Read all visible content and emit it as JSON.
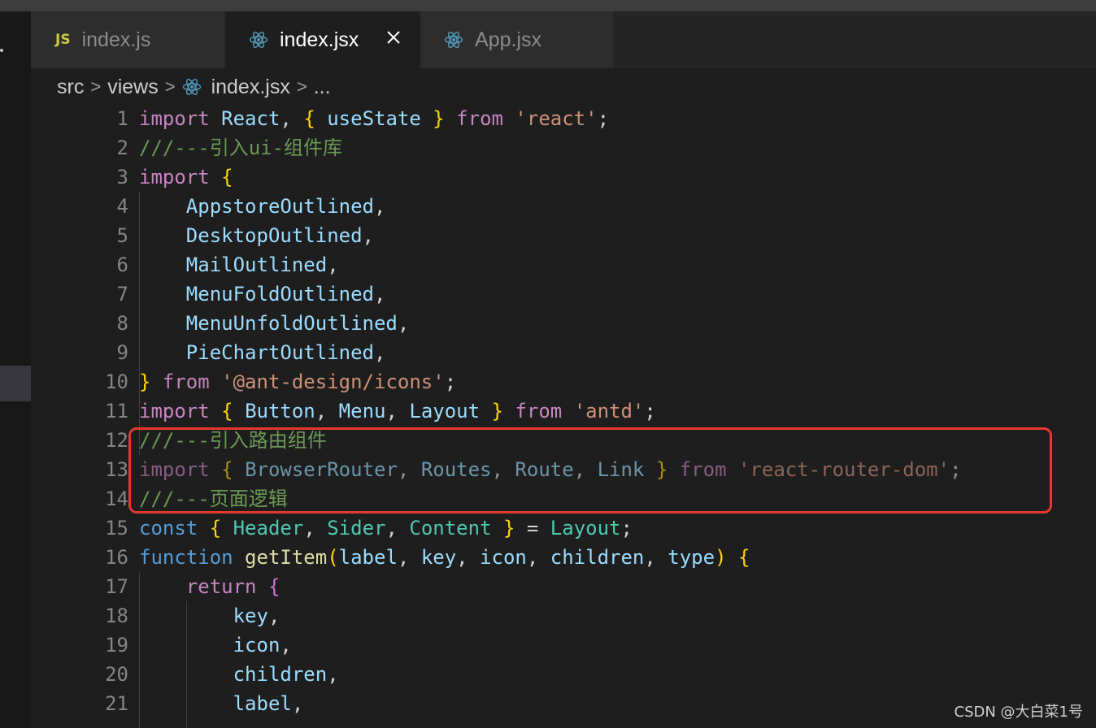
{
  "tabs": [
    {
      "label": "index.js",
      "icon": "js-file-icon",
      "badge": "JS",
      "active": false
    },
    {
      "label": "index.jsx",
      "icon": "react-icon",
      "active": true,
      "closable": true
    },
    {
      "label": "App.jsx",
      "icon": "react-icon",
      "active": false
    }
  ],
  "breadcrumb": {
    "items": [
      "src",
      "views",
      "index.jsx",
      "..."
    ],
    "separator": ">"
  },
  "code": {
    "line_numbers": [
      "1",
      "2",
      "3",
      "4",
      "5",
      "6",
      "7",
      "8",
      "9",
      "10",
      "11",
      "12",
      "13",
      "14",
      "15",
      "16",
      "17",
      "18",
      "19",
      "20",
      "21"
    ],
    "lines": [
      [
        [
          "kw",
          "import"
        ],
        [
          "p",
          " "
        ],
        [
          "id",
          "React"
        ],
        [
          "p",
          ", "
        ],
        [
          "b1",
          "{"
        ],
        [
          "p",
          " "
        ],
        [
          "id",
          "useState"
        ],
        [
          "p",
          " "
        ],
        [
          "b1",
          "}"
        ],
        [
          "p",
          " "
        ],
        [
          "kw",
          "from"
        ],
        [
          "p",
          " "
        ],
        [
          "str",
          "'react'"
        ],
        [
          "p",
          ";"
        ]
      ],
      [
        [
          "cm",
          "///---引入ui-组件库"
        ]
      ],
      [
        [
          "kw",
          "import"
        ],
        [
          "p",
          " "
        ],
        [
          "b1",
          "{"
        ]
      ],
      [
        [
          "p",
          "    "
        ],
        [
          "id",
          "AppstoreOutlined"
        ],
        [
          "p",
          ","
        ]
      ],
      [
        [
          "p",
          "    "
        ],
        [
          "id",
          "DesktopOutlined"
        ],
        [
          "p",
          ","
        ]
      ],
      [
        [
          "p",
          "    "
        ],
        [
          "id",
          "MailOutlined"
        ],
        [
          "p",
          ","
        ]
      ],
      [
        [
          "p",
          "    "
        ],
        [
          "id",
          "MenuFoldOutlined"
        ],
        [
          "p",
          ","
        ]
      ],
      [
        [
          "p",
          "    "
        ],
        [
          "id",
          "MenuUnfoldOutlined"
        ],
        [
          "p",
          ","
        ]
      ],
      [
        [
          "p",
          "    "
        ],
        [
          "id",
          "PieChartOutlined"
        ],
        [
          "p",
          ","
        ]
      ],
      [
        [
          "b1",
          "}"
        ],
        [
          "p",
          " "
        ],
        [
          "kw",
          "from"
        ],
        [
          "p",
          " "
        ],
        [
          "str",
          "'@ant-design/icons'"
        ],
        [
          "p",
          ";"
        ]
      ],
      [
        [
          "kw",
          "import"
        ],
        [
          "p",
          " "
        ],
        [
          "b1",
          "{"
        ],
        [
          "p",
          " "
        ],
        [
          "id",
          "Button"
        ],
        [
          "p",
          ", "
        ],
        [
          "id",
          "Menu"
        ],
        [
          "p",
          ", "
        ],
        [
          "id",
          "Layout"
        ],
        [
          "p",
          " "
        ],
        [
          "b1",
          "}"
        ],
        [
          "p",
          " "
        ],
        [
          "kw",
          "from"
        ],
        [
          "p",
          " "
        ],
        [
          "str",
          "'antd'"
        ],
        [
          "p",
          ";"
        ]
      ],
      [
        [
          "cm",
          "///---引入路由组件"
        ]
      ],
      [
        [
          "kw dim",
          "import"
        ],
        [
          "p dim",
          " "
        ],
        [
          "b1 dim",
          "{"
        ],
        [
          "p dim",
          " "
        ],
        [
          "id dim",
          "BrowserRouter"
        ],
        [
          "p dim",
          ", "
        ],
        [
          "id dim",
          "Routes"
        ],
        [
          "p dim",
          ", "
        ],
        [
          "id dim",
          "Route"
        ],
        [
          "p dim",
          ", "
        ],
        [
          "id dim",
          "Link"
        ],
        [
          "p dim",
          " "
        ],
        [
          "b1 dim",
          "}"
        ],
        [
          "p dim",
          " "
        ],
        [
          "kw dim",
          "from"
        ],
        [
          "p dim",
          " "
        ],
        [
          "str dim",
          "'react-router-dom'"
        ],
        [
          "p dim",
          ";"
        ]
      ],
      [
        [
          "cm",
          "///---页面逻辑"
        ]
      ],
      [
        [
          "kwb",
          "const"
        ],
        [
          "p",
          " "
        ],
        [
          "b1",
          "{"
        ],
        [
          "p",
          " "
        ],
        [
          "type",
          "Header"
        ],
        [
          "p",
          ", "
        ],
        [
          "type",
          "Sider"
        ],
        [
          "p",
          ", "
        ],
        [
          "type",
          "Content"
        ],
        [
          "p",
          " "
        ],
        [
          "b1",
          "}"
        ],
        [
          "p",
          " = "
        ],
        [
          "type",
          "Layout"
        ],
        [
          "p",
          ";"
        ]
      ],
      [
        [
          "kwb",
          "function"
        ],
        [
          "p",
          " "
        ],
        [
          "fn",
          "getItem"
        ],
        [
          "b1",
          "("
        ],
        [
          "id",
          "label"
        ],
        [
          "p",
          ", "
        ],
        [
          "id",
          "key"
        ],
        [
          "p",
          ", "
        ],
        [
          "id",
          "icon"
        ],
        [
          "p",
          ", "
        ],
        [
          "id",
          "children"
        ],
        [
          "p",
          ", "
        ],
        [
          "id",
          "type"
        ],
        [
          "b1",
          ")"
        ],
        [
          "p",
          " "
        ],
        [
          "b1",
          "{"
        ]
      ],
      [
        [
          "p",
          "    "
        ],
        [
          "kw",
          "return"
        ],
        [
          "p",
          " "
        ],
        [
          "b2",
          "{"
        ]
      ],
      [
        [
          "p",
          "        "
        ],
        [
          "id",
          "key"
        ],
        [
          "p",
          ","
        ]
      ],
      [
        [
          "p",
          "        "
        ],
        [
          "id",
          "icon"
        ],
        [
          "p",
          ","
        ]
      ],
      [
        [
          "p",
          "        "
        ],
        [
          "id",
          "children"
        ],
        [
          "p",
          ","
        ]
      ],
      [
        [
          "p",
          "        "
        ],
        [
          "id",
          "label"
        ],
        [
          "p",
          ","
        ]
      ]
    ]
  },
  "watermark": "CSDN @大白菜1号",
  "colors": {
    "highlight_box": "#e5392c",
    "editor_bg": "#1e1e1e",
    "tabbar_bg": "#252526"
  }
}
